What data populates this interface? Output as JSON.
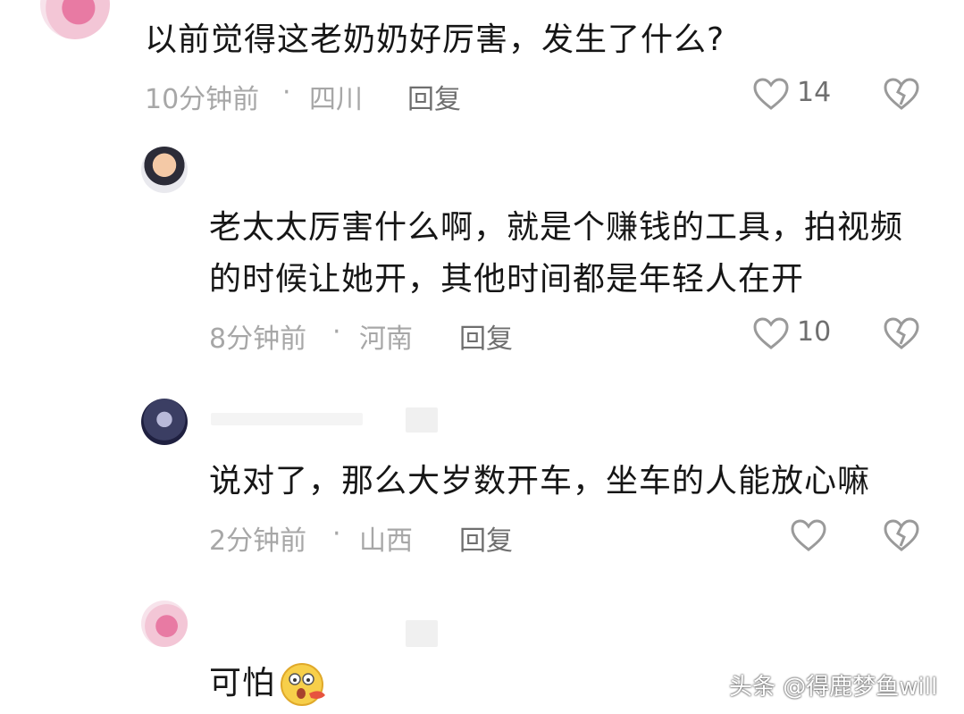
{
  "comments": [
    {
      "text": "以前觉得这老奶奶好厉害，发生了什么?",
      "time": "10分钟前",
      "sep": "·",
      "location": "四川",
      "reply_label": "回复",
      "likes": "14"
    },
    {
      "text_line1": "老太太厉害什么啊，就是个赚钱的工具，拍视频",
      "text_line2": "的时候让她开，其他时间都是年轻人在开",
      "time": "8分钟前",
      "sep": "·",
      "location": "河南",
      "reply_label": "回复",
      "likes": "10"
    },
    {
      "text": "说对了，那么大岁数开车，坐车的人能放心嘛",
      "time": "2分钟前",
      "sep": "·",
      "location": "山西",
      "reply_label": "回复",
      "likes": ""
    },
    {
      "text": "可怕",
      "emoji_icon": "scared-face-emoji-icon"
    }
  ],
  "watermark": "头条 @得鹿梦鱼will",
  "colors": {
    "meta": "#a7a7a7",
    "reply": "#6f6f6f",
    "text": "#161616",
    "icon": "#9a9a9a"
  }
}
